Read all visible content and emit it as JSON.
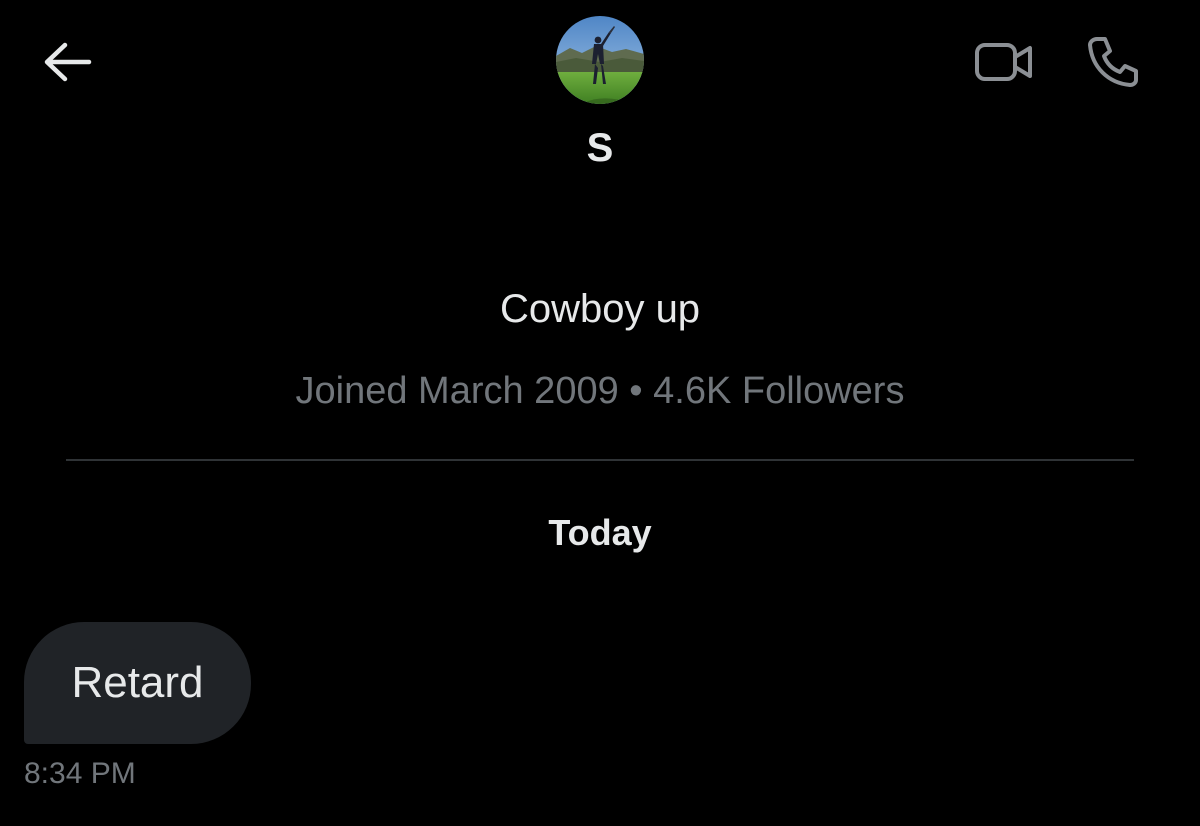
{
  "header": {
    "back_icon": "arrow-left-icon",
    "video_icon": "video-camera-icon",
    "call_icon": "phone-icon"
  },
  "profile": {
    "avatar_description_icon": "golfer-avatar",
    "display_name": "S",
    "bio": "Cowboy up",
    "meta": "Joined March 2009 • 4.6K Followers"
  },
  "conversation": {
    "date_separator": "Today",
    "messages": [
      {
        "text": "Retard",
        "time": "8:34 PM",
        "direction": "received"
      }
    ]
  },
  "colors": {
    "background": "#000000",
    "primary_text": "#e7e9ea",
    "secondary_text": "#71767b",
    "divider": "#2f3336",
    "received_bubble": "#202327",
    "icon_gray": "#8b8f94"
  }
}
